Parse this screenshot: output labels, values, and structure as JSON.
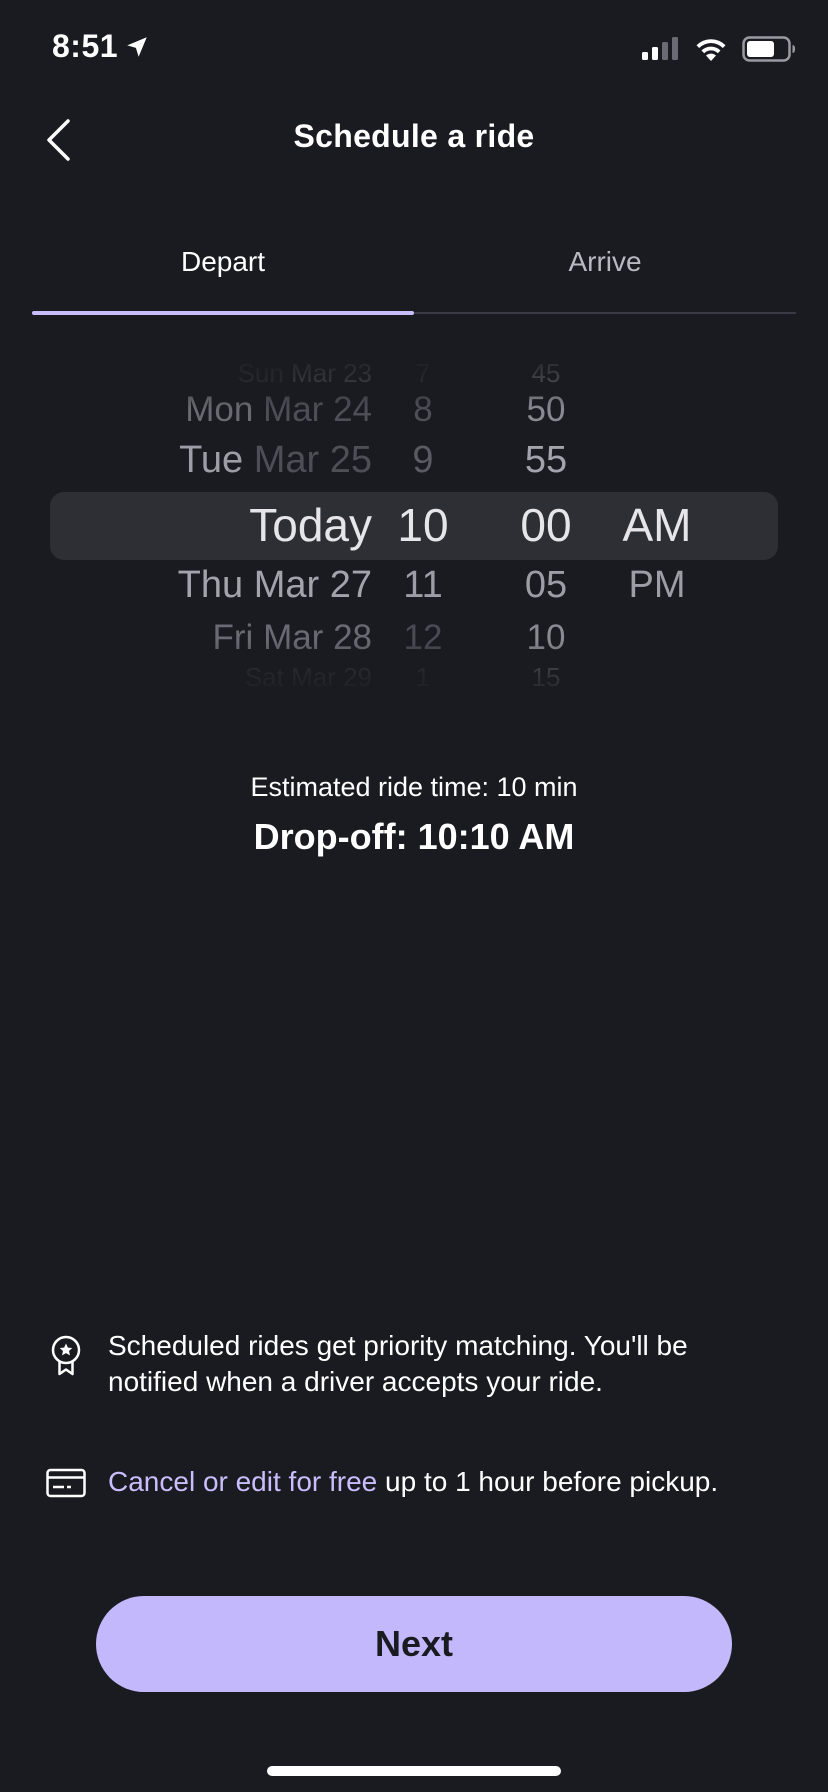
{
  "status_bar": {
    "time": "8:51"
  },
  "header": {
    "title": "Schedule a ride"
  },
  "tabs": [
    {
      "label": "Depart",
      "active": true
    },
    {
      "label": "Arrive",
      "active": false
    }
  ],
  "picker": {
    "dates": [
      {
        "day": "Sun",
        "date": "Mar 23"
      },
      {
        "day": "Mon",
        "date": "Mar 24"
      },
      {
        "day": "Tue",
        "date": "Mar 25"
      },
      {
        "day": "Today",
        "date": ""
      },
      {
        "day": "Thu",
        "date": "Mar 27"
      },
      {
        "day": "Fri",
        "date": "Mar 28"
      },
      {
        "day": "Sat",
        "date": "Mar 29"
      }
    ],
    "hours": [
      "7",
      "8",
      "9",
      "10",
      "11",
      "12",
      "1"
    ],
    "minutes": [
      "45",
      "50",
      "55",
      "00",
      "05",
      "10",
      "15"
    ],
    "ampm": [
      "AM",
      "PM"
    ],
    "selected": {
      "date": "Today",
      "hour": "10",
      "minute": "00",
      "ampm": "AM"
    }
  },
  "estimate": {
    "ride_time": "Estimated ride time: 10 min",
    "dropoff": "Drop-off: 10:10 AM"
  },
  "info": {
    "priority_text": "Scheduled rides get priority matching. You'll be notified when a driver accepts your ride.",
    "cancel_link": "Cancel or edit for free",
    "cancel_rest": " up to 1 hour before pickup."
  },
  "next_button": {
    "label": "Next"
  },
  "colors": {
    "background": "#1a1a21",
    "accent": "#c3b8fb",
    "link": "#c9bdfb"
  }
}
